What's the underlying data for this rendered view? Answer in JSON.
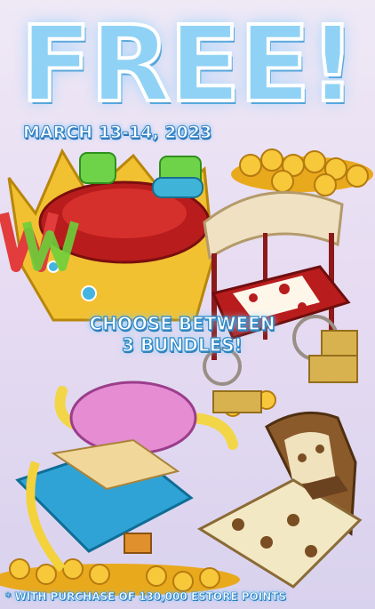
{
  "headline": "FREE!",
  "date": "MARCH 13-14, 2023",
  "promo": {
    "line1": "CHOOSE BETWEEN",
    "line2": "3 BUNDLES!"
  },
  "footnote": "* WITH PURCHASE OF 130,000 ESTORE POINTS",
  "bundles": [
    "crown-bed-bundle",
    "wagon-bed-bundle",
    "viking-bed-bundle",
    "paw-print-bed-bundle"
  ],
  "colors": {
    "background": "#e7dcf2",
    "headline": "#8fd2f5",
    "text_outline": "#2e88c6",
    "gold": "#f2c132",
    "red": "#b81c1c"
  }
}
